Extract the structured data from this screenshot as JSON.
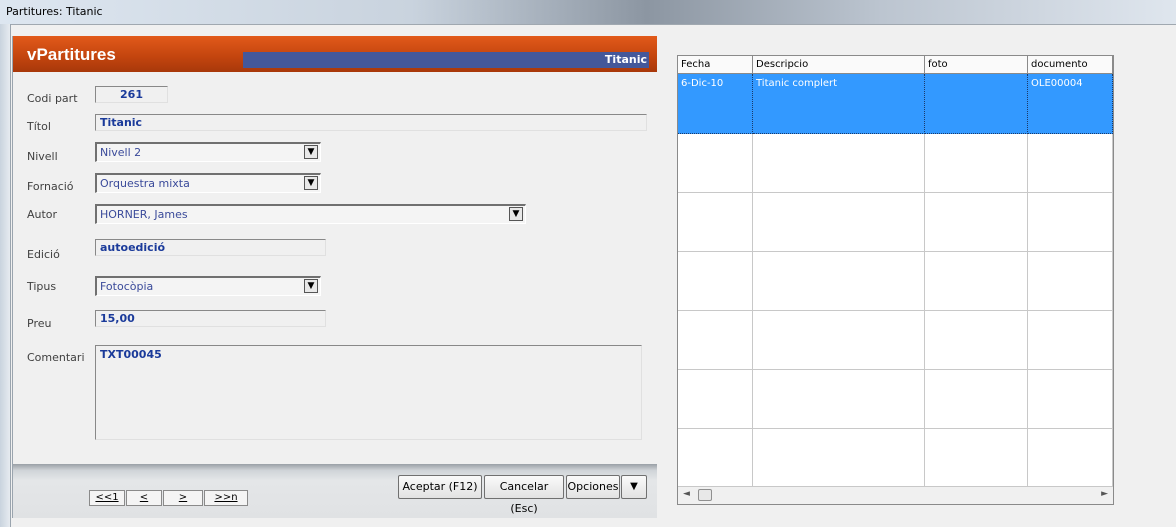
{
  "window": {
    "title": "Partitures: Titanic"
  },
  "header": {
    "form_title": "vPartitures",
    "record_title": "Titanic"
  },
  "fields": {
    "codi_part": {
      "label": "Codi part",
      "value": "261"
    },
    "titol": {
      "label": "Títol",
      "value": "Titanic"
    },
    "nivell": {
      "label": "Nivell",
      "value": "Nivell 2"
    },
    "formacio": {
      "label": "Fornació",
      "value": "Orquestra mixta"
    },
    "autor": {
      "label": "Autor",
      "value": "HORNER, James"
    },
    "edicio": {
      "label": "Edició",
      "value": "autoedició"
    },
    "tipus": {
      "label": "Tipus",
      "value": "Fotocòpia"
    },
    "preu": {
      "label": "Preu",
      "value": "15,00"
    },
    "comentari": {
      "label": "Comentari",
      "value": "TXT00045"
    }
  },
  "nav": {
    "first": "<<1",
    "prev": "<",
    "next": ">",
    "last": ">>n"
  },
  "actions": {
    "accept": "Aceptar (F12)",
    "cancel": "Cancelar (Esc)",
    "options": "Opciones"
  },
  "grid": {
    "columns": [
      "Fecha",
      "Descripcio",
      "foto",
      "documento"
    ],
    "rows": [
      {
        "fecha": "6-Dic-10",
        "descripcio": "Titanic complert",
        "foto": "",
        "documento": "OLE00004"
      }
    ]
  }
}
